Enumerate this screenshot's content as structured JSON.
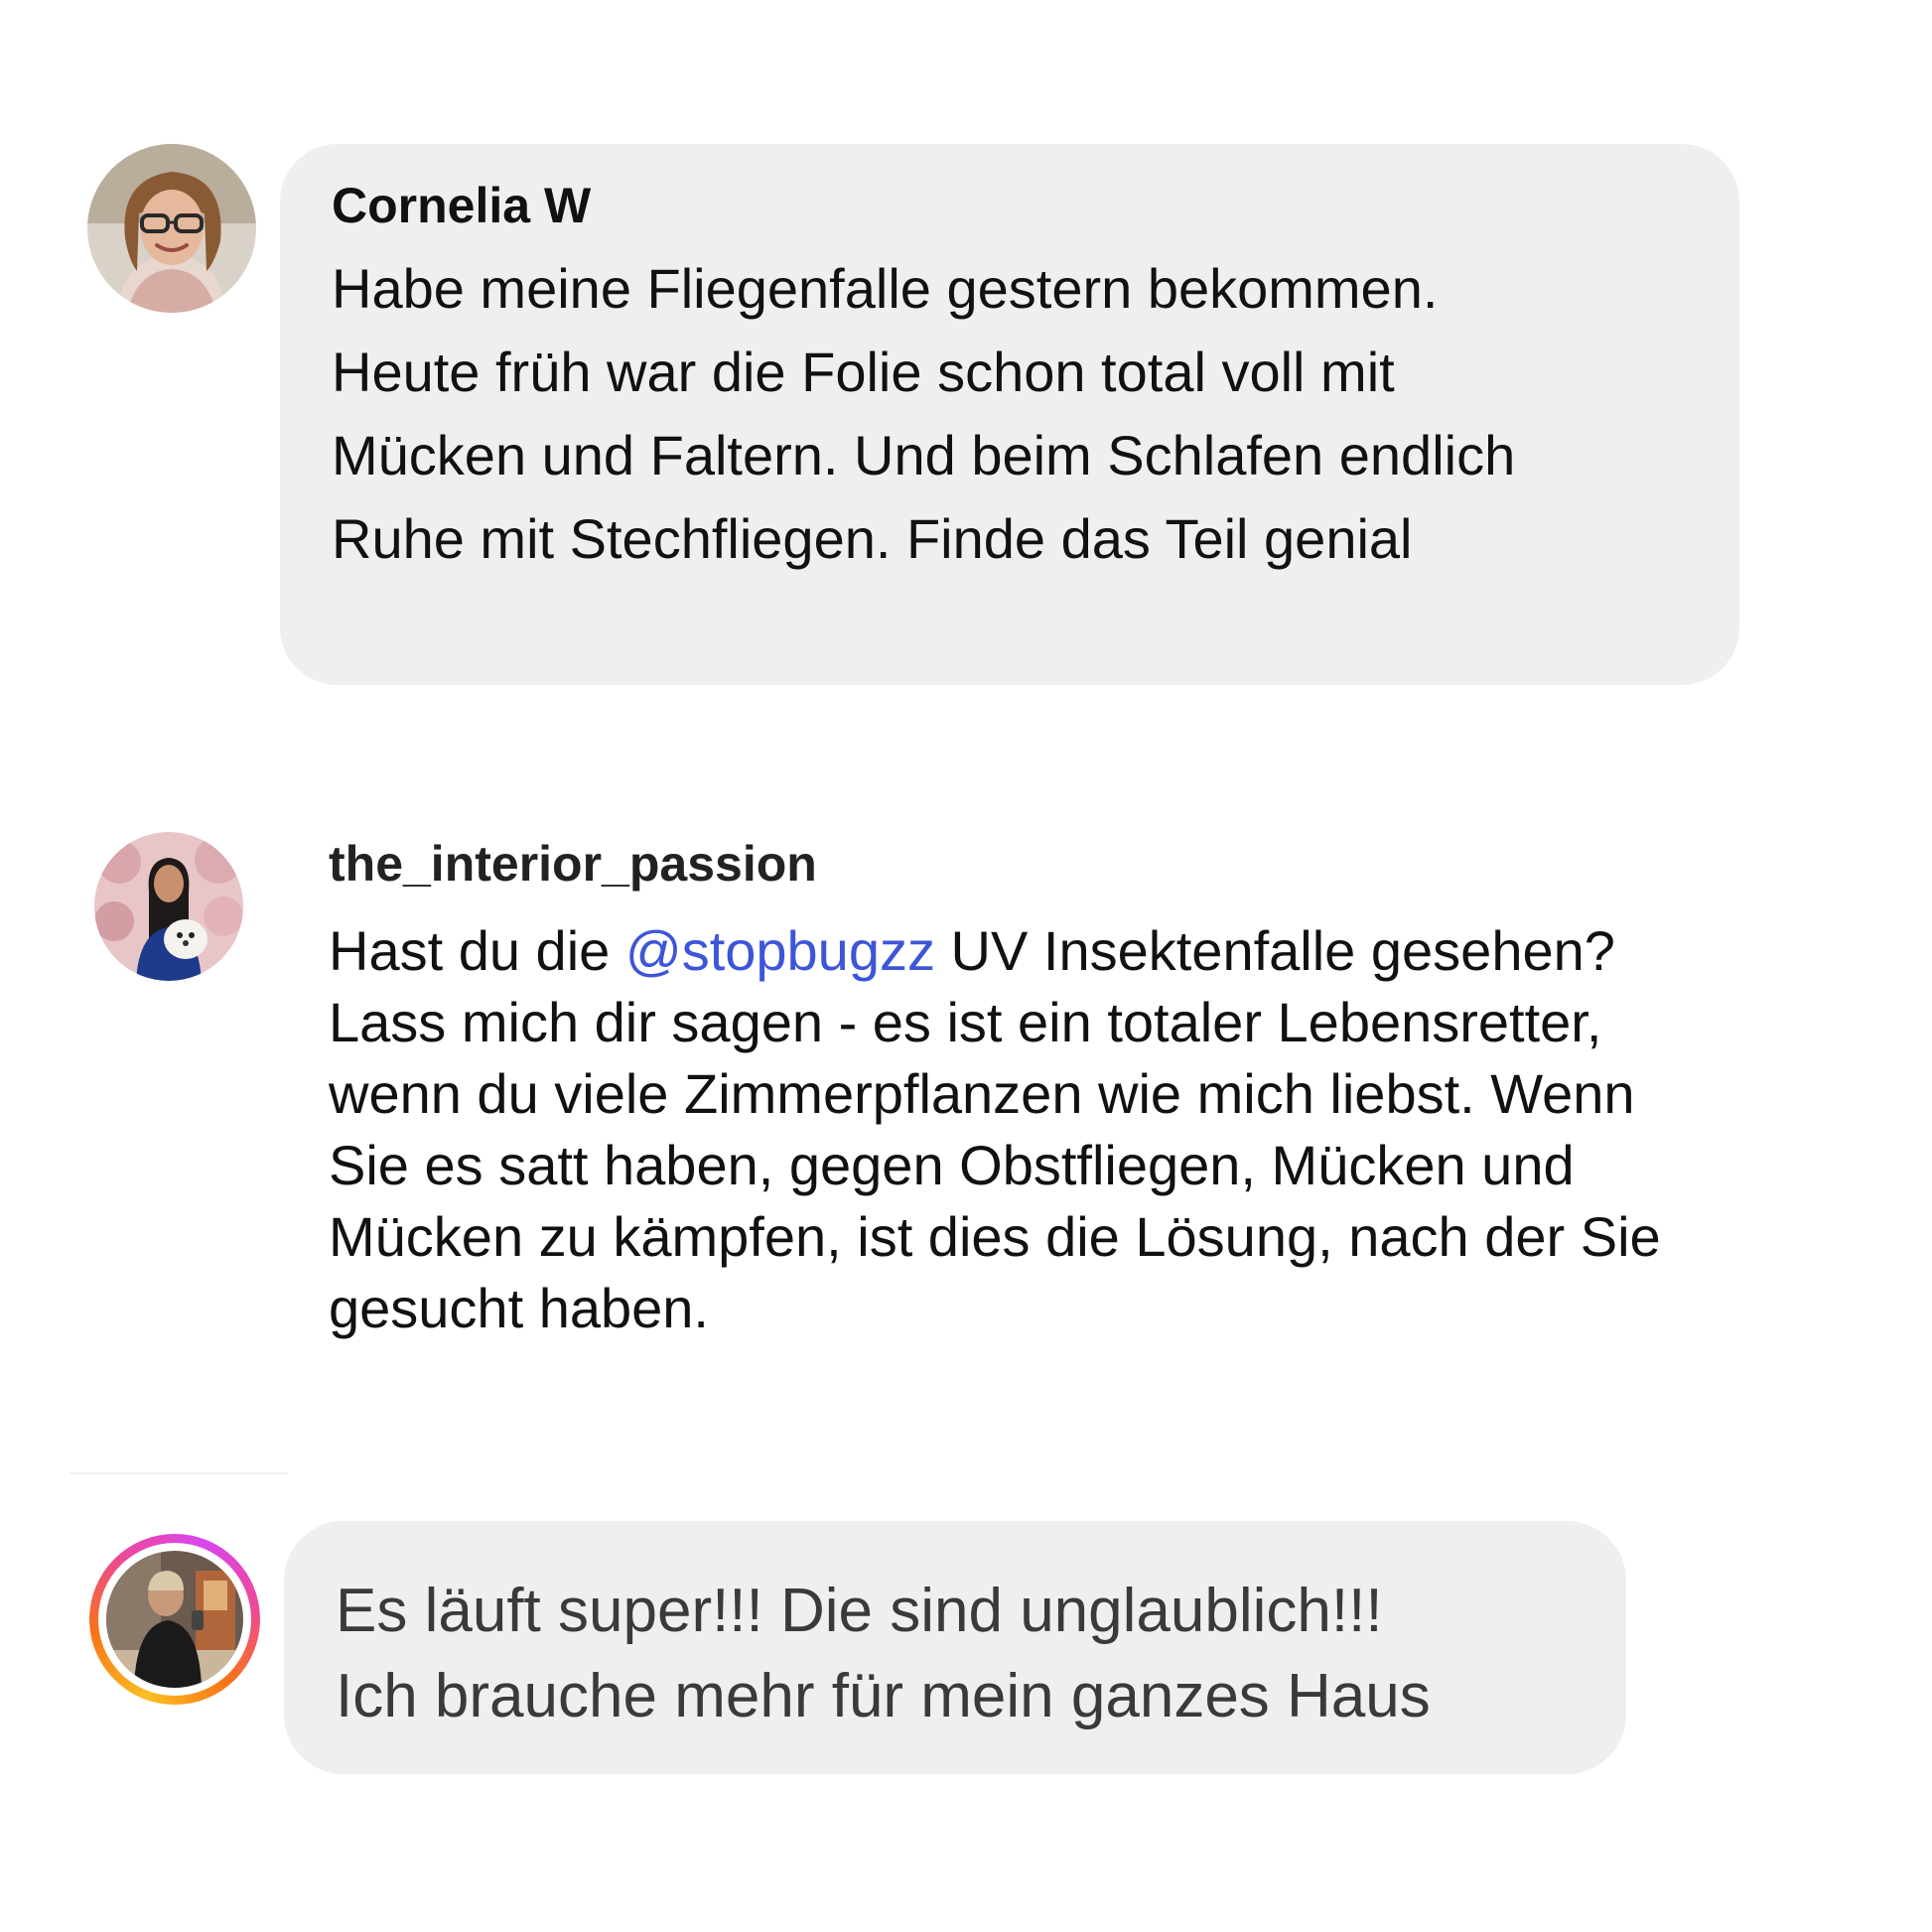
{
  "comments": [
    {
      "author": "Cornelia W",
      "text": "Habe meine Fliegenfalle gestern bekommen.\nHeute früh war die Folie schon total voll mit\nMücken und Faltern. Und beim Schlafen endlich\nRuhe mit Stechfliegen. Finde das Teil genial",
      "avatar_icon": "user-avatar-woman-glasses"
    },
    {
      "author": "the_interior_passion",
      "text_before": "Hast du die ",
      "mention": "@stopbugzz",
      "text_after": " UV Insektenfalle gesehen?\nLass mich dir sagen - es ist ein totaler Lebensretter,\nwenn du viele Zimmerpflanzen wie mich liebst. Wenn\nSie es satt haben, gegen Obstfliegen, Mücken und\nMücken zu kämpfen, ist dies die Lösung, nach der Sie\ngesucht haben.",
      "mention_color": "#3d55d8",
      "avatar_icon": "user-avatar-woman-with-dog"
    },
    {
      "author": "",
      "text": "Es läuft super!!! Die sind unglaublich!!!\nIch brauche mehr für mein ganzes Haus",
      "avatar_icon": "user-avatar-story-ring"
    }
  ],
  "colors": {
    "bubble_background": "#efeff2",
    "mention": "#3d55d8",
    "story_ring_gradient": [
      "#fbbf24",
      "#f97316",
      "#ec4899",
      "#d946ef"
    ]
  }
}
